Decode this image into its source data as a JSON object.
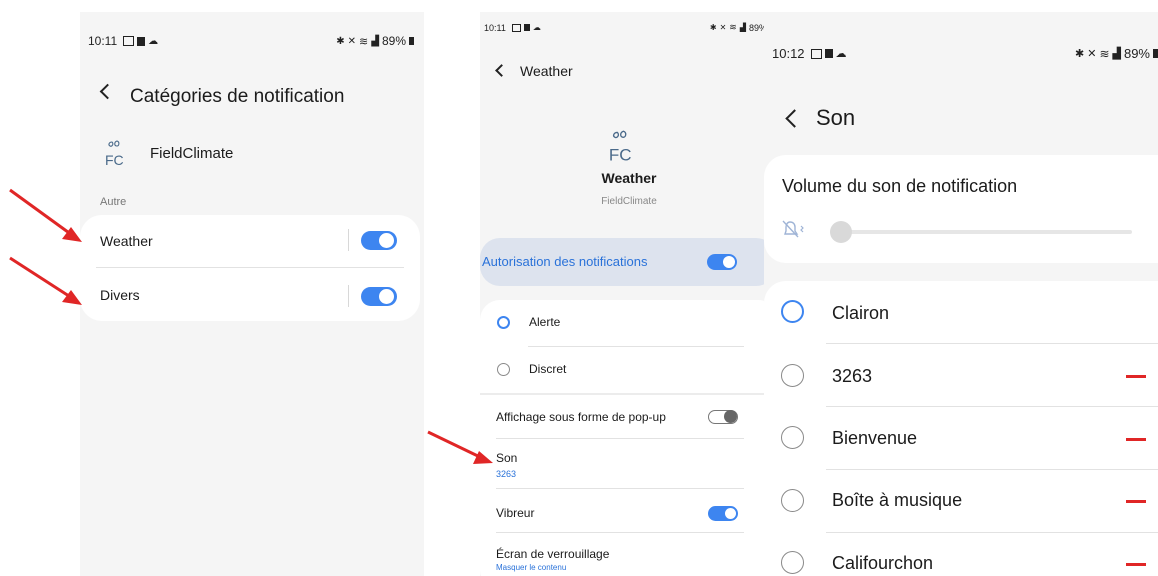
{
  "colors": {
    "accent": "#3d85f0",
    "arrow": "#e02626",
    "panel_bg": "#f5f5f5"
  },
  "panel1": {
    "status": {
      "time": "10:11",
      "battery": "89%"
    },
    "title": "Catégories de notification",
    "app_name": "FieldClimate",
    "app_logo_top": "FC",
    "section": "Autre",
    "items": [
      {
        "label": "Weather",
        "enabled": true
      },
      {
        "label": "Divers",
        "enabled": true
      }
    ]
  },
  "panel2": {
    "status": {
      "time": "10:11",
      "battery": "89%"
    },
    "title": "Weather",
    "channel_name": "Weather",
    "channel_app": "FieldClimate",
    "allow_label": "Autorisation des notifications",
    "allow_enabled": true,
    "alert_label": "Alerte",
    "silent_label": "Discret",
    "popup_label": "Affichage sous forme de pop-up",
    "popup_enabled": false,
    "sound_label": "Son",
    "sound_value": "3263",
    "vibrate_label": "Vibreur",
    "vibrate_enabled": true,
    "lock_label": "Écran de verrouillage",
    "lock_value": "Masquer le contenu"
  },
  "panel3": {
    "status": {
      "time": "10:12",
      "battery": "89%"
    },
    "title": "Son",
    "volume_label": "Volume du son de notification",
    "volume_level": 0,
    "sounds": [
      {
        "label": "Clairon",
        "selected": true,
        "removable": false
      },
      {
        "label": "3263",
        "selected": false,
        "removable": true
      },
      {
        "label": "Bienvenue",
        "selected": false,
        "removable": true
      },
      {
        "label": "Boîte à musique",
        "selected": false,
        "removable": true
      },
      {
        "label": "Califourchon",
        "selected": false,
        "removable": true
      }
    ]
  }
}
